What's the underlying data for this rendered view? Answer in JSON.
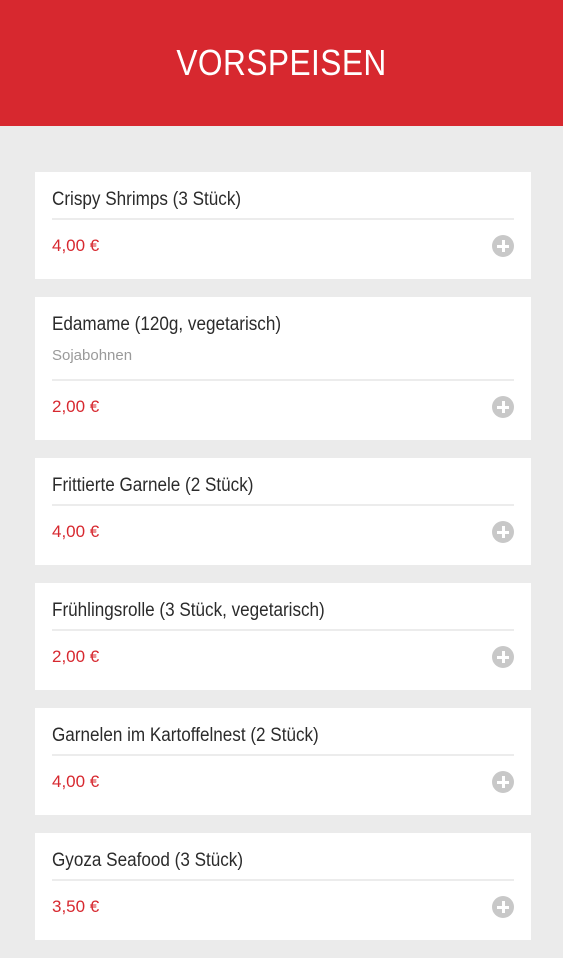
{
  "header": {
    "title": "VORSPEISEN",
    "background": "#d7282f"
  },
  "items": [
    {
      "name": "Crispy Shrimps (3 Stück)",
      "description": "",
      "price": "4,00 €"
    },
    {
      "name": "Edamame (120g, vegetarisch)",
      "description": "Sojabohnen",
      "price": "2,00 €"
    },
    {
      "name": "Frittierte Garnele (2 Stück)",
      "description": "",
      "price": "4,00 €"
    },
    {
      "name": "Frühlingsrolle (3 Stück, vegetarisch)",
      "description": "",
      "price": "2,00 €"
    },
    {
      "name": "Garnelen im Kartoffelnest (2 Stück)",
      "description": "",
      "price": "4,00 €"
    },
    {
      "name": "Gyoza Seafood (3 Stück)",
      "description": "",
      "price": "3,50 €"
    }
  ],
  "colors": {
    "accent": "#d7282f",
    "background": "#ebebeb",
    "card": "#ffffff",
    "icon": "#c8c8c8"
  },
  "icons": {
    "add": "add-circle-icon"
  }
}
